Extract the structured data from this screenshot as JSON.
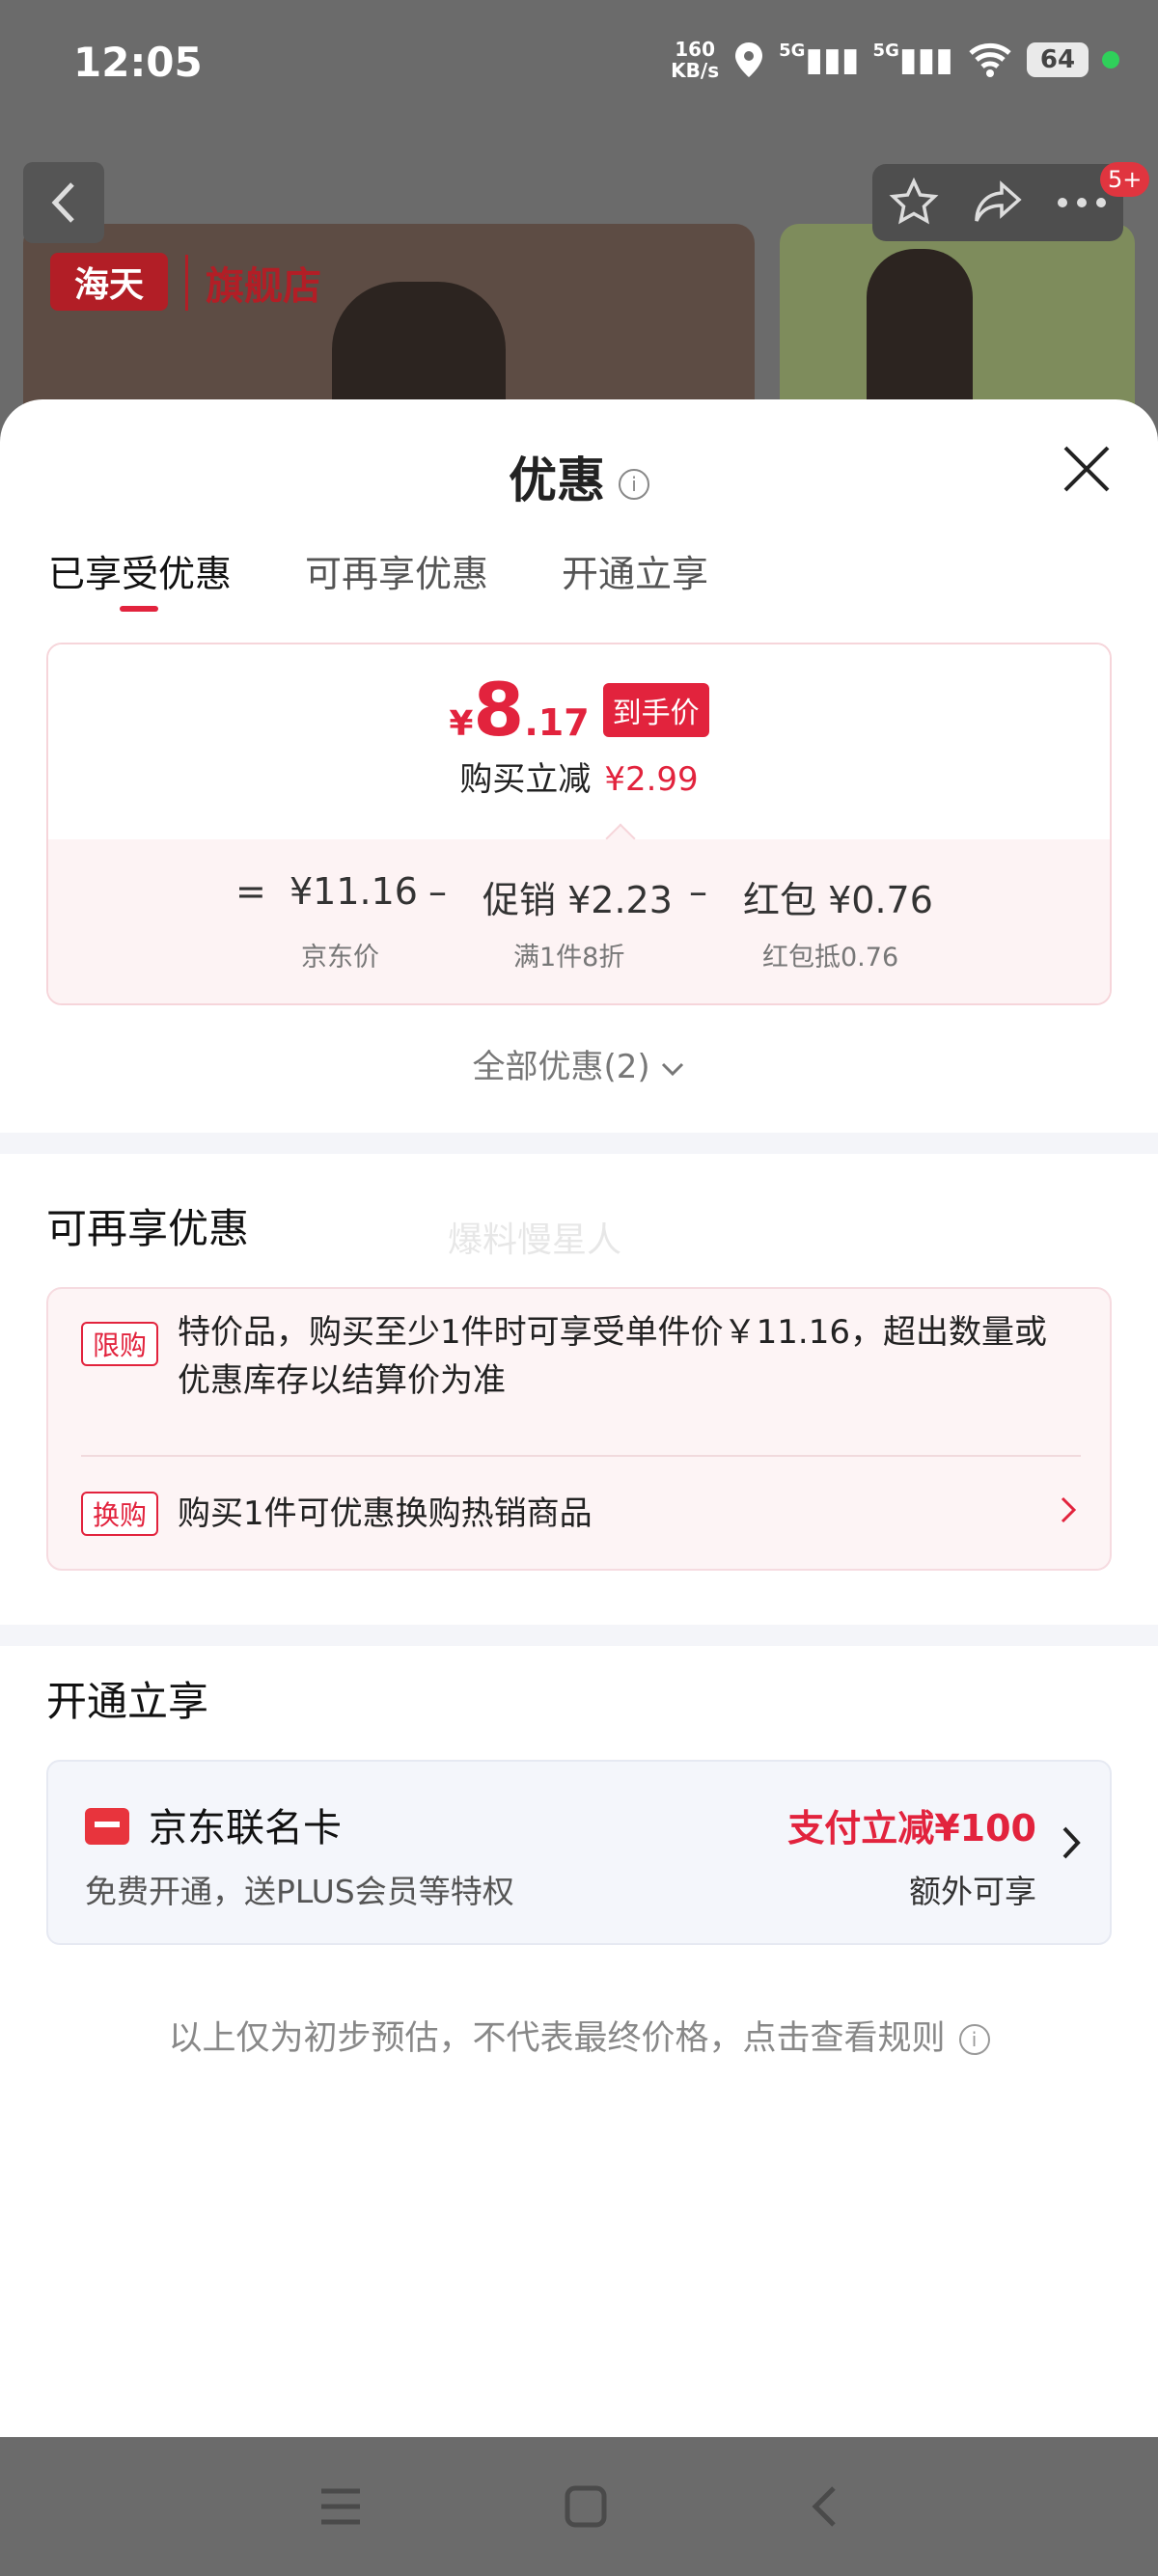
{
  "status_bar": {
    "time": "12:05",
    "net_speed_value": "160",
    "net_speed_unit": "KB/s",
    "sig1": "5G",
    "sig2": "5G",
    "battery": "64"
  },
  "top_bar": {
    "badge": "5+"
  },
  "banner": {
    "logo": "海天",
    "store": "旗舰店"
  },
  "sheet": {
    "title": "优惠",
    "tabs": [
      "已享受优惠",
      "可再享优惠",
      "开通立享"
    ],
    "price": {
      "currency": "¥",
      "integer": "8",
      "decimal": ".17",
      "tag": "到手价",
      "reduce_label": "购买立减",
      "reduce_value": "¥2.99",
      "equals": "=",
      "minus": "–",
      "jd_price": "¥11.16",
      "jd_price_label": "京东价",
      "promo_name": "促销",
      "promo_value": "¥2.23",
      "promo_label": "满1件8折",
      "redpack_name": "红包",
      "redpack_value": "¥0.76",
      "redpack_label": "红包抵0.76"
    },
    "all_promos": "全部优惠(2)",
    "section2": {
      "title": "可再享优惠",
      "watermark": "爆料慢星人",
      "items": [
        {
          "tag": "限购",
          "text_line1": "特价品，购买至少1件时可享受单件价￥11.16，超出数量或",
          "text_line2": "优惠库存以结算价为准"
        },
        {
          "tag": "换购",
          "text_line1": "购买1件可优惠换购热销商品"
        }
      ]
    },
    "section3": {
      "title": "开通立享",
      "card_name": "京东联名卡",
      "card_desc": "免费开通，送PLUS会员等特权",
      "card_offer": "支付立减¥100",
      "card_extra": "额外可享"
    },
    "disclaimer": "以上仅为初步预估，不代表最终价格，点击查看规则"
  },
  "icons": [
    "location-icon",
    "wifi-icon",
    "star-icon",
    "share-icon",
    "more-icon",
    "close-icon",
    "info-icon",
    "card-icon"
  ],
  "colors": {
    "accent": "#e2233d",
    "overlay": "#6b6b6b"
  }
}
